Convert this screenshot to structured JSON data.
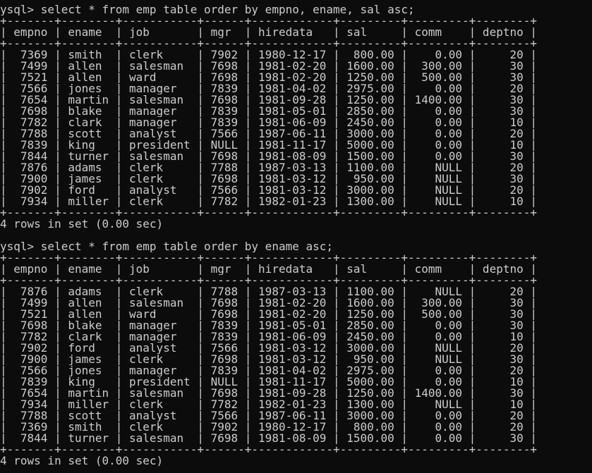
{
  "terminal": {
    "blocks": [
      {
        "command": "ysql> select * from emp_table order by empno, ename, sal asc;",
        "separator": "+-------+--------+-----------+------+------------+---------+---------+--------+",
        "header": "| empno | ename  | job       | mgr  | hiredata   | sal     | comm    | deptno |",
        "rows": [
          "|  7369 | smith  | clerk     | 7902 | 1980-12-17 |  800.00 |    0.00 |     20 |",
          "|  7499 | allen  | salesman  | 7698 | 1981-02-20 | 1600.00 |  300.00 |     30 |",
          "|  7521 | allen  | ward      | 7698 | 1981-02-20 | 1250.00 |  500.00 |     30 |",
          "|  7566 | jones  | manager   | 7839 | 1981-04-02 | 2975.00 |    0.00 |     20 |",
          "|  7654 | martin | salesman  | 7698 | 1981-09-28 | 1250.00 | 1400.00 |     30 |",
          "|  7698 | blake  | manager   | 7839 | 1981-05-01 | 2850.00 |    0.00 |     30 |",
          "|  7782 | clark  | manager   | 7839 | 1981-06-09 | 2450.00 |    0.00 |     10 |",
          "|  7788 | scott  | analyst   | 7566 | 1987-06-11 | 3000.00 |    0.00 |     20 |",
          "|  7839 | king   | president | NULL | 1981-11-17 | 5000.00 |    0.00 |     10 |",
          "|  7844 | turner | salesman  | 7698 | 1981-08-09 | 1500.00 |    0.00 |     30 |",
          "|  7876 | adams  | clerk     | 7788 | 1987-03-13 | 1100.00 |    NULL |     20 |",
          "|  7900 | james  | clerk     | 7698 | 1981-03-12 |  950.00 |    NULL |     30 |",
          "|  7902 | ford   | analyst   | 7566 | 1981-03-12 | 3000.00 |    NULL |     20 |",
          "|  7934 | miller | clerk     | 7782 | 1982-01-23 | 1300.00 |    NULL |     10 |"
        ],
        "status": "4 rows in set (0.00 sec)"
      },
      {
        "command": "ysql> select * from emp_table order by ename asc;",
        "separator": "+-------+--------+-----------+------+------------+---------+---------+--------+",
        "header": "| empno | ename  | job       | mgr  | hiredata   | sal     | comm    | deptno |",
        "rows": [
          "|  7876 | adams  | clerk     | 7788 | 1987-03-13 | 1100.00 |    NULL |     20 |",
          "|  7499 | allen  | salesman  | 7698 | 1981-02-20 | 1600.00 |  300.00 |     30 |",
          "|  7521 | allen  | ward      | 7698 | 1981-02-20 | 1250.00 |  500.00 |     30 |",
          "|  7698 | blake  | manager   | 7839 | 1981-05-01 | 2850.00 |    0.00 |     30 |",
          "|  7782 | clark  | manager   | 7839 | 1981-06-09 | 2450.00 |    0.00 |     10 |",
          "|  7902 | ford   | analyst   | 7566 | 1981-03-12 | 3000.00 |    NULL |     20 |",
          "|  7900 | james  | clerk     | 7698 | 1981-03-12 |  950.00 |    NULL |     30 |",
          "|  7566 | jones  | manager   | 7839 | 1981-04-02 | 2975.00 |    0.00 |     20 |",
          "|  7839 | king   | president | NULL | 1981-11-17 | 5000.00 |    0.00 |     10 |",
          "|  7654 | martin | salesman  | 7698 | 1981-09-28 | 1250.00 | 1400.00 |     30 |",
          "|  7934 | miller | clerk     | 7782 | 1982-01-23 | 1300.00 |    NULL |     10 |",
          "|  7788 | scott  | analyst   | 7566 | 1987-06-11 | 3000.00 |    0.00 |     20 |",
          "|  7369 | smith  | clerk     | 7902 | 1980-12-17 |  800.00 |    0.00 |     20 |",
          "|  7844 | turner | salesman  | 7698 | 1981-08-09 | 1500.00 |    0.00 |     30 |"
        ],
        "status": "4 rows in set (0.00 sec)"
      }
    ]
  }
}
